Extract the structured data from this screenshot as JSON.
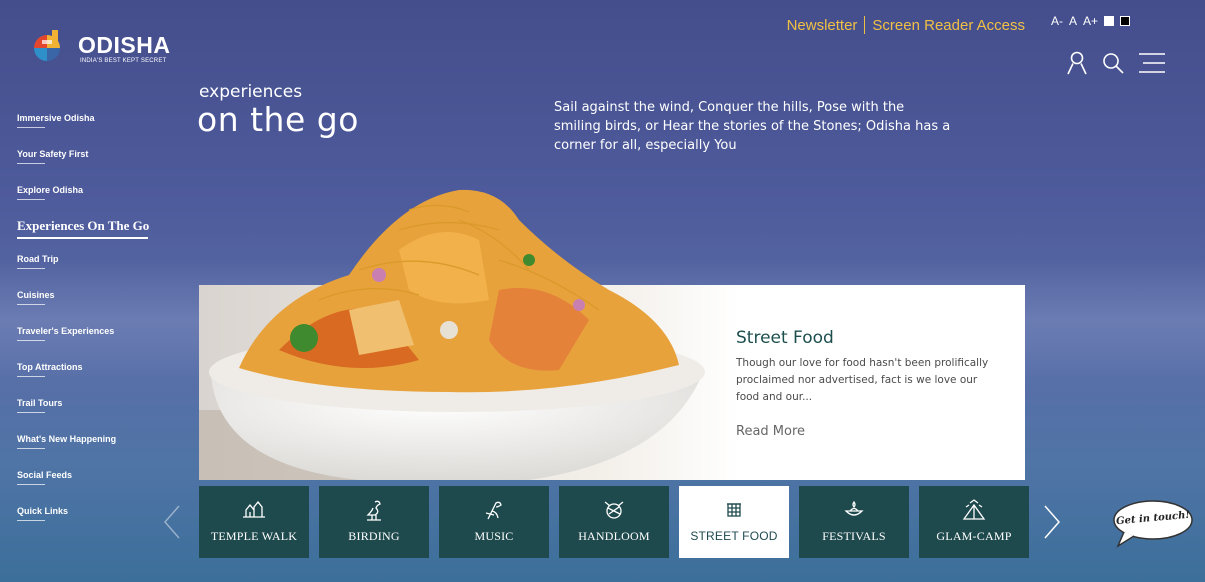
{
  "brand": {
    "name": "ODISHA",
    "tagline": "INDIA'S BEST KEPT SECRET"
  },
  "topbar": {
    "newsletter": "Newsletter",
    "screen_reader": "Screen Reader Access",
    "font_small": "A-",
    "font_normal": "A",
    "font_large": "A+"
  },
  "sidebar": {
    "items": [
      {
        "label": "Immersive Odisha"
      },
      {
        "label": "Your Safety First"
      },
      {
        "label": "Explore Odisha"
      },
      {
        "label": "Experiences On The Go"
      },
      {
        "label": "Road Trip"
      },
      {
        "label": "Cuisines"
      },
      {
        "label": "Traveler's Experiences"
      },
      {
        "label": "Top Attractions"
      },
      {
        "label": "Trail Tours"
      },
      {
        "label": "What's New Happening"
      },
      {
        "label": "Social Feeds"
      },
      {
        "label": "Quick Links"
      }
    ],
    "active_index": 3
  },
  "hero": {
    "small": "experiences",
    "big": "on the go",
    "intro": "Sail against the wind, Conquer the hills, Pose with the smiling birds, or Hear the stories of the Stones; Odisha has a corner for all, especially You"
  },
  "feature": {
    "title": "Street Food",
    "description": "Though our love for food hasn't been prolifically proclaimed nor advertised, fact is we love our food and our...",
    "read_more": "Read More"
  },
  "tabs": [
    {
      "label": "TEMPLE WALK",
      "icon": "temple-icon"
    },
    {
      "label": "BIRDING",
      "icon": "bird-icon"
    },
    {
      "label": "MUSIC",
      "icon": "music-icon"
    },
    {
      "label": "HANDLOOM",
      "icon": "yarn-icon"
    },
    {
      "label": "STREET FOOD",
      "icon": "food-cart-icon"
    },
    {
      "label": "FESTIVALS",
      "icon": "lamp-icon"
    },
    {
      "label": "GLAM-CAMP",
      "icon": "tent-icon"
    }
  ],
  "active_tab": 4,
  "contact": {
    "label": "Get in touch!"
  },
  "colors": {
    "accent": "#f0c044",
    "tab_bg": "#1f4a4d",
    "title": "#1d4e4e"
  }
}
